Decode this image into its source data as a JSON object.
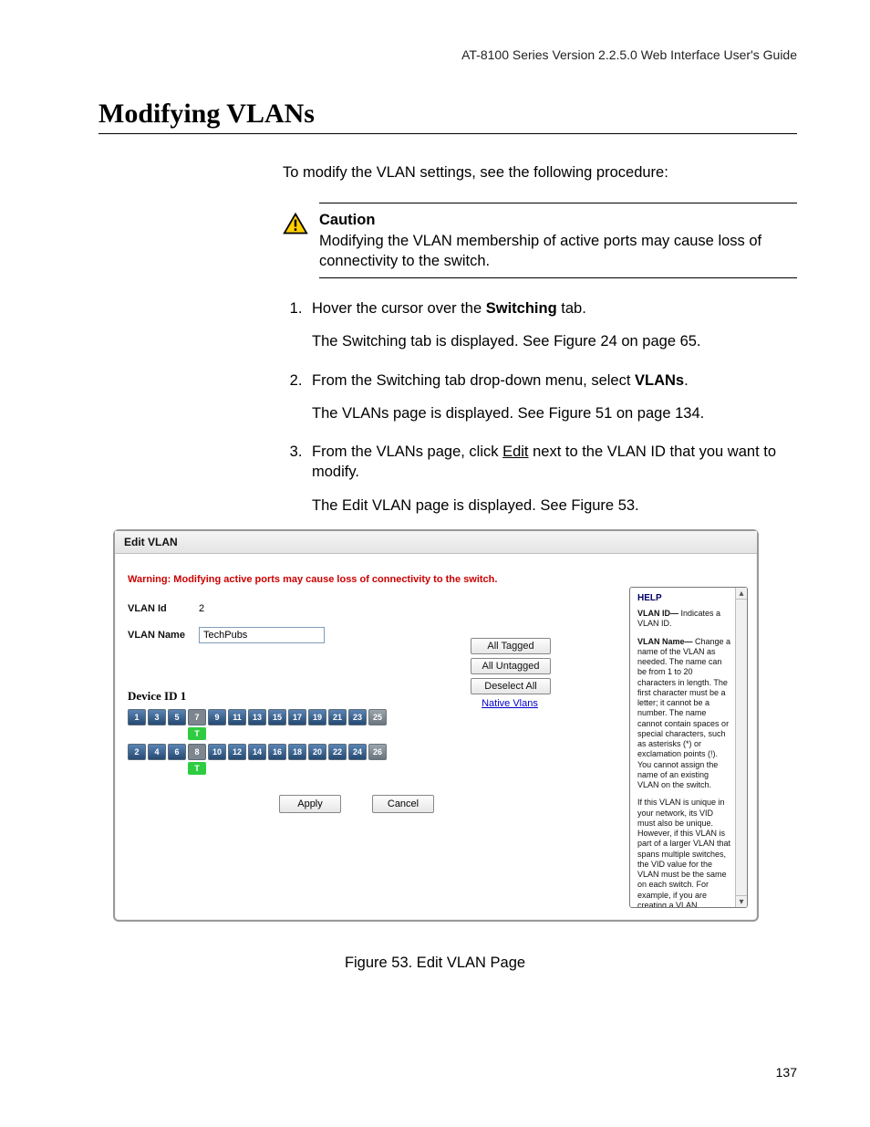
{
  "header": {
    "right": "AT-8100 Series Version 2.2.5.0 Web Interface User's Guide"
  },
  "title": "Modifying VLANs",
  "intro": "To modify the VLAN settings, see the following procedure:",
  "caution": {
    "heading": "Caution",
    "text": "Modifying the VLAN membership of active ports may cause loss of connectivity to the switch."
  },
  "steps": [
    {
      "pre": "Hover the cursor over the ",
      "bold": "Switching",
      "post": " tab.",
      "sub": "The Switching tab is displayed. See Figure 24 on page 65."
    },
    {
      "pre": "From the Switching tab drop-down menu, select ",
      "bold": "VLANs",
      "post": ".",
      "sub": "The VLANs page is displayed. See Figure 51 on page 134."
    },
    {
      "pre": "From the VLANs page, click ",
      "underline": "Edit",
      "post": " next to the VLAN ID that you want to modify.",
      "sub": "The Edit VLAN page is displayed. See Figure 53."
    }
  ],
  "panel": {
    "title": "Edit VLAN",
    "warning": "Warning: Modifying active ports may cause loss of connectivity to the switch.",
    "fields": {
      "vlan_id_label": "VLAN Id",
      "vlan_id_value": "2",
      "vlan_name_label": "VLAN Name",
      "vlan_name_value": "TechPubs"
    },
    "side_buttons": {
      "all_tagged": "All Tagged",
      "all_untagged": "All Untagged",
      "deselect_all": "Deselect All",
      "native_vlans": "Native Vlans"
    },
    "device_title": "Device ID 1",
    "ports": {
      "row1": [
        {
          "n": "1",
          "type": "blue"
        },
        {
          "n": "3",
          "type": "blue"
        },
        {
          "n": "5",
          "type": "blue"
        },
        {
          "n": "7",
          "type": "grey",
          "flag": "T"
        },
        {
          "n": "9",
          "type": "blue"
        },
        {
          "n": "11",
          "type": "blue"
        },
        {
          "n": "13",
          "type": "blue"
        },
        {
          "n": "15",
          "type": "blue"
        },
        {
          "n": "17",
          "type": "blue"
        },
        {
          "n": "19",
          "type": "blue"
        },
        {
          "n": "21",
          "type": "blue"
        },
        {
          "n": "23",
          "type": "blue"
        },
        {
          "n": "25",
          "type": "dim"
        }
      ],
      "row2": [
        {
          "n": "2",
          "type": "blue"
        },
        {
          "n": "4",
          "type": "blue"
        },
        {
          "n": "6",
          "type": "blue"
        },
        {
          "n": "8",
          "type": "grey",
          "flag": "T"
        },
        {
          "n": "10",
          "type": "blue"
        },
        {
          "n": "12",
          "type": "blue"
        },
        {
          "n": "14",
          "type": "blue"
        },
        {
          "n": "16",
          "type": "blue"
        },
        {
          "n": "18",
          "type": "blue"
        },
        {
          "n": "20",
          "type": "blue"
        },
        {
          "n": "22",
          "type": "blue"
        },
        {
          "n": "24",
          "type": "blue"
        },
        {
          "n": "26",
          "type": "dim"
        }
      ]
    },
    "form_buttons": {
      "apply": "Apply",
      "cancel": "Cancel"
    },
    "help": {
      "title": "HELP",
      "p1_bold": "VLAN ID—",
      "p1": " Indicates a VLAN ID.",
      "p2_bold": "VLAN Name—",
      "p2": " Change a name of the VLAN as needed. The name can be from 1 to 20 characters in length. The first character must be a letter; it cannot be a number. The name cannot contain spaces or special characters, such as asterisks (*) or exclamation points (!). You cannot assign the name of an existing VLAN on the switch.",
      "p3": "If this VLAN is unique in your network, its VID must also be unique. However, if this VLAN is part of a larger VLAN that spans multiple switches, the VID value for the VLAN must be the same on each switch. For example, if you are creating a VLAN"
    }
  },
  "figure_caption": "Figure 53. Edit VLAN Page",
  "page_number": "137"
}
